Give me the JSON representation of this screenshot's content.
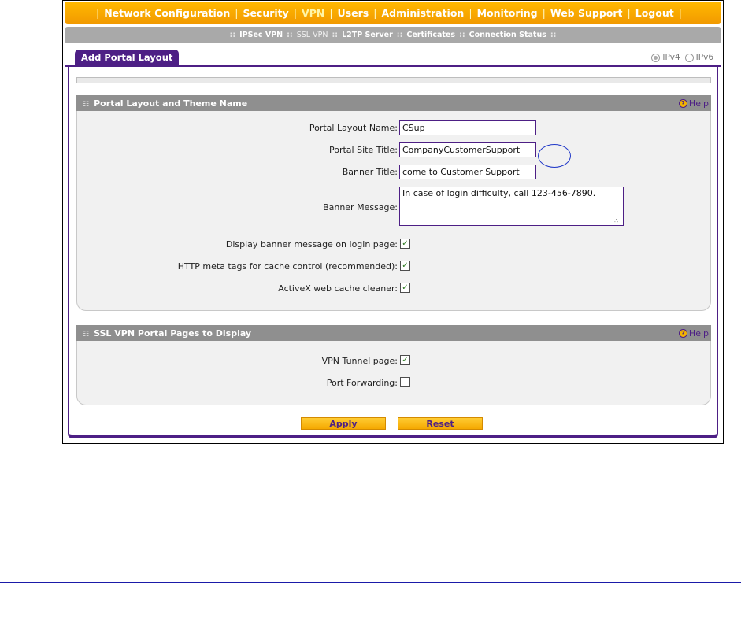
{
  "topnav": {
    "items": [
      "Network Configuration",
      "Security",
      "VPN",
      "Users",
      "Administration",
      "Monitoring",
      "Web Support",
      "Logout"
    ],
    "active": "VPN"
  },
  "subnav": {
    "items": [
      "IPSec VPN",
      "SSL VPN",
      "L2TP Server",
      "Certificates",
      "Connection Status"
    ],
    "active": "SSL VPN"
  },
  "tab": {
    "label": "Add Portal Layout"
  },
  "ip_version": {
    "options": [
      "IPv4",
      "IPv6"
    ],
    "selected": "IPv4"
  },
  "section1": {
    "title": "Portal Layout and Theme Name",
    "help": "Help",
    "fields": {
      "portal_layout_name": {
        "label": "Portal Layout Name:",
        "value": "CSup"
      },
      "portal_site_title": {
        "label": "Portal Site Title:",
        "value": "CompanyCustomerSupport"
      },
      "banner_title": {
        "label": "Banner Title:",
        "value": "come to Customer Support"
      },
      "banner_message": {
        "label": "Banner Message:",
        "value": "In case of login difficulty, call 123-456-7890."
      },
      "display_banner": {
        "label": "Display banner message on login page:",
        "checked": true
      },
      "http_meta": {
        "label": "HTTP meta tags for cache control (recommended):",
        "checked": true
      },
      "activex": {
        "label": "ActiveX web cache cleaner:",
        "checked": true
      }
    }
  },
  "section2": {
    "title": "SSL VPN Portal Pages to Display",
    "help": "Help",
    "fields": {
      "vpn_tunnel": {
        "label": "VPN Tunnel page:",
        "checked": true
      },
      "port_forwarding": {
        "label": "Port Forwarding:",
        "checked": false
      }
    }
  },
  "buttons": {
    "apply": "Apply",
    "reset": "Reset"
  },
  "colors": {
    "accent": "#4d1f85",
    "nav": "#f5a800",
    "button": "#ffcc33"
  }
}
